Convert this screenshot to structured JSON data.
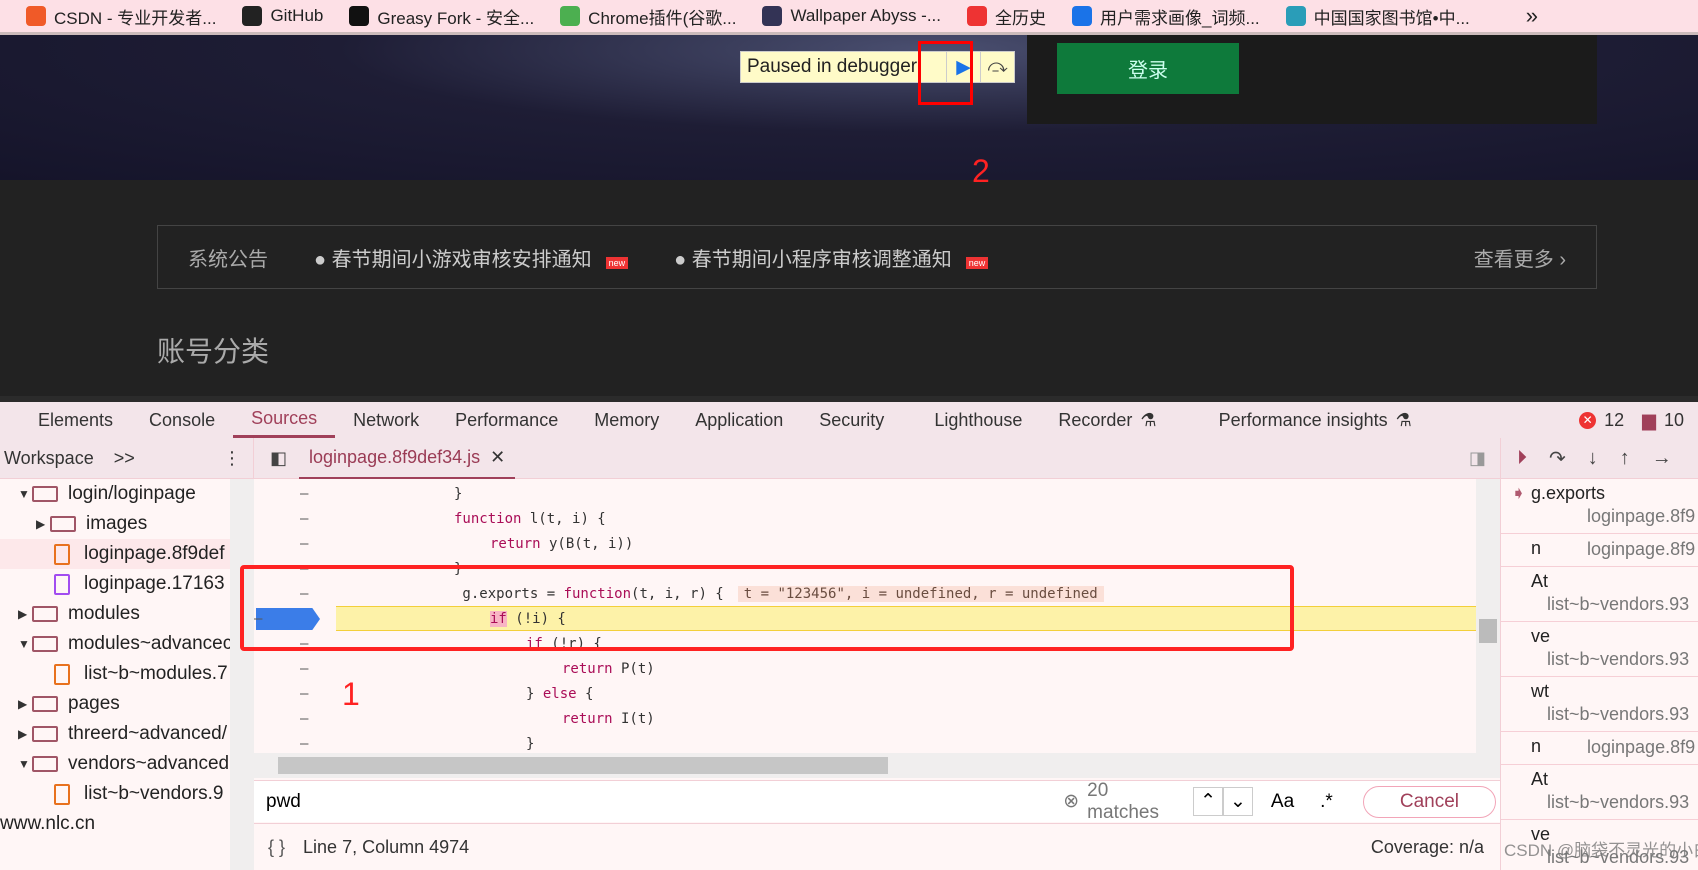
{
  "bookmarks": [
    "CSDN - 专业开发者...",
    "GitHub",
    "Greasy Fork - 安全...",
    "Chrome插件(谷歌...",
    "Wallpaper Abyss -...",
    "全历史",
    "用户需求画像_词频...",
    "中国国家图书馆•中..."
  ],
  "bookmarks_more": "»",
  "page": {
    "paused_label": "Paused in debugger",
    "login_button": "登录",
    "notice_title": "系统公告",
    "notices": [
      "春节期间小游戏审核安排通知",
      "春节期间小程序审核调整通知"
    ],
    "new_badge": "new",
    "more": "查看更多",
    "section_title": "账号分类",
    "annotation_1": "1",
    "annotation_2": "2"
  },
  "devtools": {
    "tabs": [
      "Elements",
      "Console",
      "Sources",
      "Network",
      "Performance",
      "Memory",
      "Application",
      "Security",
      "Lighthouse",
      "Recorder",
      "Performance insights"
    ],
    "active_tab": "Sources",
    "errors": "12",
    "messages": "10"
  },
  "sidebar": {
    "header": "Workspace",
    "more": ">>",
    "tree": [
      {
        "label": "login/loginpage",
        "type": "folder",
        "open": true,
        "depth": 1
      },
      {
        "label": "images",
        "type": "folder",
        "open": false,
        "depth": 2
      },
      {
        "label": "loginpage.8f9def",
        "type": "js",
        "depth": 2
      },
      {
        "label": "loginpage.17163",
        "type": "css",
        "depth": 2
      },
      {
        "label": "modules",
        "type": "folder",
        "open": false,
        "depth": 1
      },
      {
        "label": "modules~advancec",
        "type": "folder",
        "open": true,
        "depth": 1
      },
      {
        "label": "list~b~modules.7",
        "type": "js",
        "depth": 2
      },
      {
        "label": "pages",
        "type": "folder",
        "open": false,
        "depth": 1
      },
      {
        "label": "threerd~advanced/",
        "type": "folder",
        "open": false,
        "depth": 1
      },
      {
        "label": "vendors~advanced",
        "type": "folder",
        "open": true,
        "depth": 1
      },
      {
        "label": "list~b~vendors.9",
        "type": "js",
        "depth": 2
      },
      {
        "label": "www.nlc.cn",
        "type": "domain",
        "depth": 0
      }
    ]
  },
  "editor": {
    "file_tab": "loginpage.8f9def34.js",
    "lines": [
      {
        "indent": 0,
        "parts": [
          [
            "",
            "}"
          ]
        ]
      },
      {
        "indent": 0,
        "parts": [
          [
            "kw",
            "function"
          ],
          [
            "",
            " l(t, i) {"
          ]
        ]
      },
      {
        "indent": 1,
        "parts": [
          [
            "kw",
            "return"
          ],
          [
            "",
            " y(B(t, i))"
          ]
        ]
      },
      {
        "indent": 0,
        "parts": [
          [
            "",
            "}"
          ]
        ]
      },
      {
        "indent": 0,
        "parts": [
          [
            "",
            " g.exports = "
          ],
          [
            "kw",
            "function"
          ],
          [
            "",
            "(t, i, r) {"
          ]
        ],
        "inline": "t = \"123456\", i = undefined, r = undefined"
      },
      {
        "indent": 1,
        "parts": [
          [
            "kwhl",
            "if"
          ],
          [
            "",
            " (!i) {"
          ]
        ],
        "current": true
      },
      {
        "indent": 2,
        "parts": [
          [
            "kw",
            "if"
          ],
          [
            "",
            " (!r) {"
          ]
        ]
      },
      {
        "indent": 3,
        "parts": [
          [
            "kw",
            "return"
          ],
          [
            "",
            " P(t)"
          ]
        ]
      },
      {
        "indent": 2,
        "parts": [
          [
            "",
            "} "
          ],
          [
            "kw",
            "else"
          ],
          [
            "",
            " {"
          ]
        ]
      },
      {
        "indent": 3,
        "parts": [
          [
            "kw",
            "return"
          ],
          [
            "",
            " I(t)"
          ]
        ]
      },
      {
        "indent": 2,
        "parts": [
          [
            "",
            "}"
          ]
        ]
      }
    ]
  },
  "search": {
    "value": "pwd",
    "matches": "20 matches",
    "case_label": "Aa",
    "regex_label": ".*",
    "cancel": "Cancel"
  },
  "status": {
    "position": "Line 7, Column 4974",
    "coverage": "Coverage: n/a"
  },
  "call_stack": [
    {
      "name": "g.exports",
      "loc": "loginpage.8f9",
      "current": true
    },
    {
      "name": "n",
      "loc": "loginpage.8f9"
    },
    {
      "name": "At",
      "loc": "list~b~vendors.93"
    },
    {
      "name": "ve",
      "loc": "list~b~vendors.93"
    },
    {
      "name": "wt",
      "loc": "list~b~vendors.93"
    },
    {
      "name": "n",
      "loc": "loginpage.8f9"
    },
    {
      "name": "At",
      "loc": "list~b~vendors.93"
    },
    {
      "name": "ve",
      "loc": "list~b~vendors.93"
    }
  ],
  "watermark": "CSDN @脑袋不灵光的小白羊"
}
